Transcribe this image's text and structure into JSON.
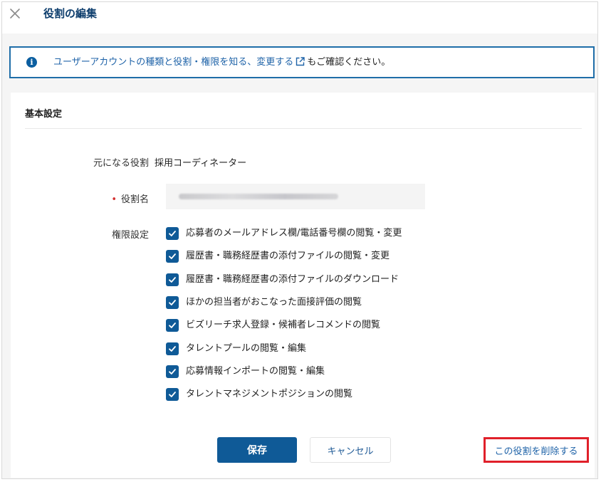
{
  "header": {
    "title": "役割の編集",
    "close_icon": "close-icon"
  },
  "info": {
    "icon": "info-icon",
    "link_text": "ユーザーアカウントの種類と役割・権限を知る、変更する",
    "link_icon": "external-link-icon",
    "suffix": "もご確認ください。"
  },
  "basic": {
    "section_title": "基本設定",
    "base_role_label": "元になる役割",
    "base_role_value": "採用コーディネーター",
    "required_mark": "•",
    "role_name_label": "役割名",
    "permissions_label": "権限設定"
  },
  "permissions": [
    {
      "label": "応募者のメールアドレス欄/電話番号欄の閲覧・変更",
      "checked": true
    },
    {
      "label": "履歴書・職務経歴書の添付ファイルの閲覧・変更",
      "checked": true
    },
    {
      "label": "履歴書・職務経歴書の添付ファイルのダウンロード",
      "checked": true
    },
    {
      "label": "ほかの担当者がおこなった面接評価の閲覧",
      "checked": true
    },
    {
      "label": "ビズリーチ求人登録・候補者レコメンドの閲覧",
      "checked": true
    },
    {
      "label": "タレントプールの閲覧・編集",
      "checked": true
    },
    {
      "label": "応募情報インポートの閲覧・編集",
      "checked": true
    },
    {
      "label": "タレントマネジメントポジションの閲覧",
      "checked": true
    }
  ],
  "actions": {
    "save": "保存",
    "cancel": "キャンセル",
    "delete": "この役割を削除する"
  },
  "colors": {
    "primary": "#0f5a97",
    "link": "#1f63a8",
    "highlight": "#e0202a",
    "required": "#d32f2f"
  }
}
